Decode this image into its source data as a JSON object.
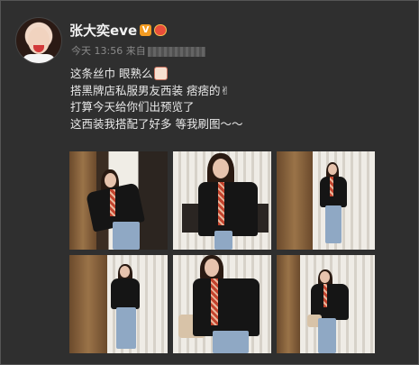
{
  "post": {
    "username": "张大奕eve",
    "verified_badge": "V",
    "time": "今天 13:56",
    "source_prefix": "来自",
    "lines": [
      "这条丝巾 眼熟么",
      "搭黑牌店私服男友西装 痞痞的✌",
      "打算今天给你们出预览了",
      "这西装我搭配了好多 等我刷图～～"
    ]
  },
  "photos": [
    {
      "name": "photo-1"
    },
    {
      "name": "photo-2"
    },
    {
      "name": "photo-3"
    },
    {
      "name": "photo-4"
    },
    {
      "name": "photo-5"
    },
    {
      "name": "photo-6"
    }
  ],
  "colors": {
    "background": "#2f2f2f",
    "badge_orange": "#f29b22"
  }
}
